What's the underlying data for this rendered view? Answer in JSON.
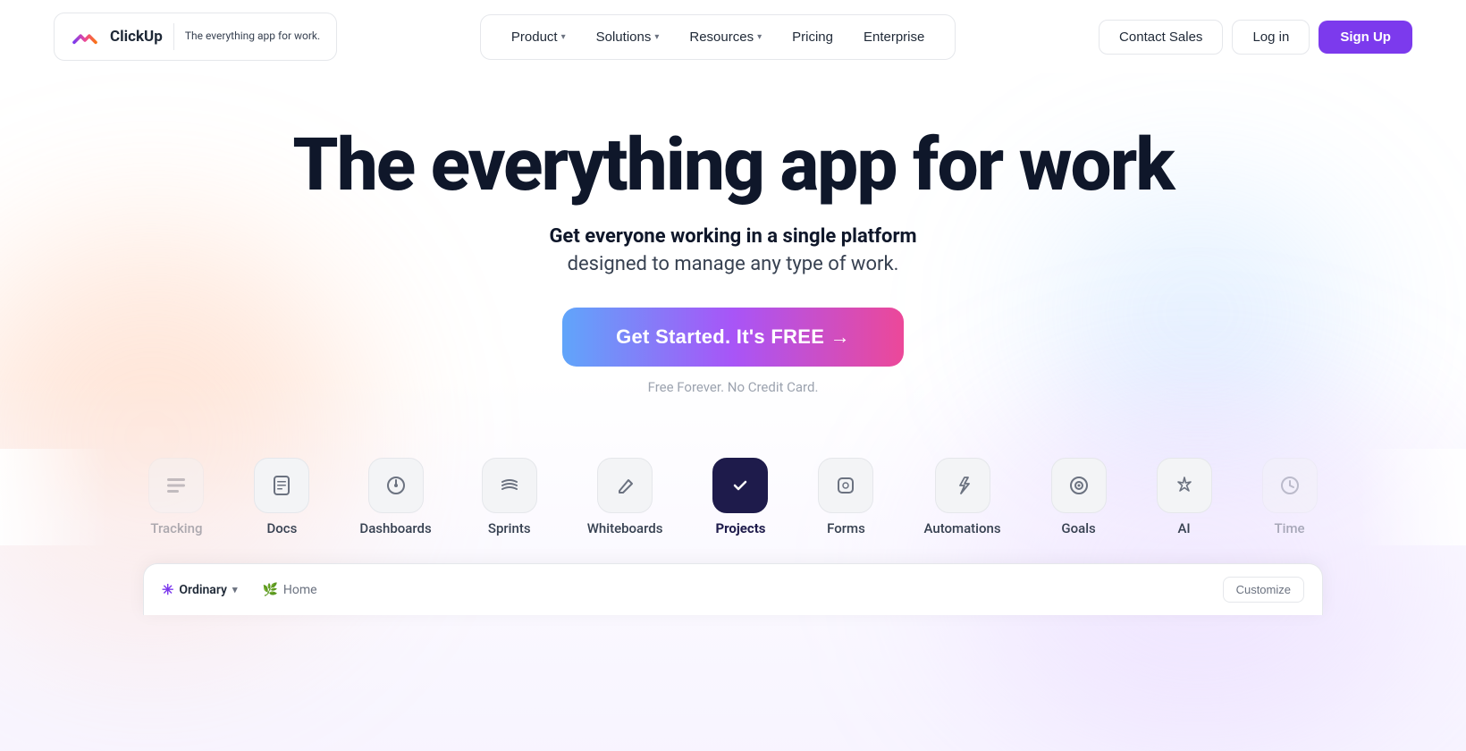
{
  "nav": {
    "logo": {
      "name": "ClickUp",
      "tagline": "The everything\napp for work."
    },
    "items": [
      {
        "label": "Product",
        "hasDropdown": true
      },
      {
        "label": "Solutions",
        "hasDropdown": true
      },
      {
        "label": "Resources",
        "hasDropdown": true
      },
      {
        "label": "Pricing",
        "hasDropdown": false
      },
      {
        "label": "Enterprise",
        "hasDropdown": false
      }
    ],
    "contact_sales": "Contact Sales",
    "login": "Log in",
    "signup": "Sign Up"
  },
  "hero": {
    "title": "The everything app for work",
    "subtitle_bold": "Get everyone working in a single platform",
    "subtitle": "designed to manage any type of work.",
    "cta_label": "Get Started. It's FREE →",
    "sub_note": "Free Forever. No Credit Card."
  },
  "features": [
    {
      "id": "tracking",
      "label": "Tracking",
      "icon": "≡",
      "active": false,
      "partial": true
    },
    {
      "id": "docs",
      "label": "Docs",
      "icon": "📄",
      "active": false
    },
    {
      "id": "dashboards",
      "label": "Dashboards",
      "icon": "🎧",
      "active": false
    },
    {
      "id": "sprints",
      "label": "Sprints",
      "icon": "≋",
      "active": false
    },
    {
      "id": "whiteboards",
      "label": "Whiteboards",
      "icon": "✏️",
      "active": false
    },
    {
      "id": "projects",
      "label": "Projects",
      "icon": "✓",
      "active": true
    },
    {
      "id": "forms",
      "label": "Forms",
      "icon": "⊡",
      "active": false
    },
    {
      "id": "automations",
      "label": "Automations",
      "icon": "⚡",
      "active": false
    },
    {
      "id": "goals",
      "label": "Goals",
      "icon": "◎",
      "active": false
    },
    {
      "id": "ai",
      "label": "AI",
      "icon": "✦",
      "active": false
    },
    {
      "id": "time",
      "label": "Time",
      "icon": "⏱",
      "active": false,
      "partial": true
    }
  ],
  "app_preview": {
    "workspace": "Ordinary",
    "workspace_icon": "✳",
    "nav_item": "Home",
    "nav_item_icon": "🌿",
    "customize_label": "Customize"
  }
}
